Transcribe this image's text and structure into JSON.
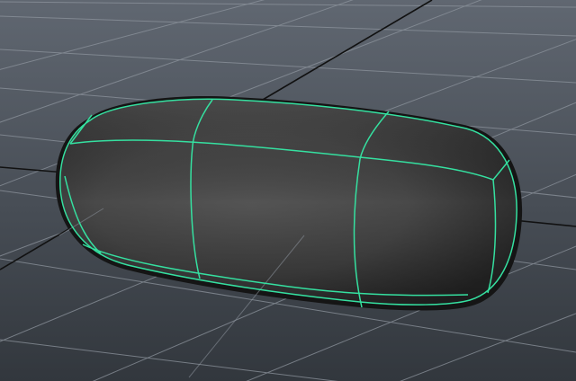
{
  "viewport": {
    "view": "perspective",
    "background_top": "#5f6670",
    "background_bottom": "#33383e",
    "grid_color": "#8a919a",
    "axis_color": "#111111"
  },
  "object": {
    "shape": "capsule",
    "shading": "dark-grey",
    "wireframe_color": "#35e0a0",
    "selected": true
  }
}
